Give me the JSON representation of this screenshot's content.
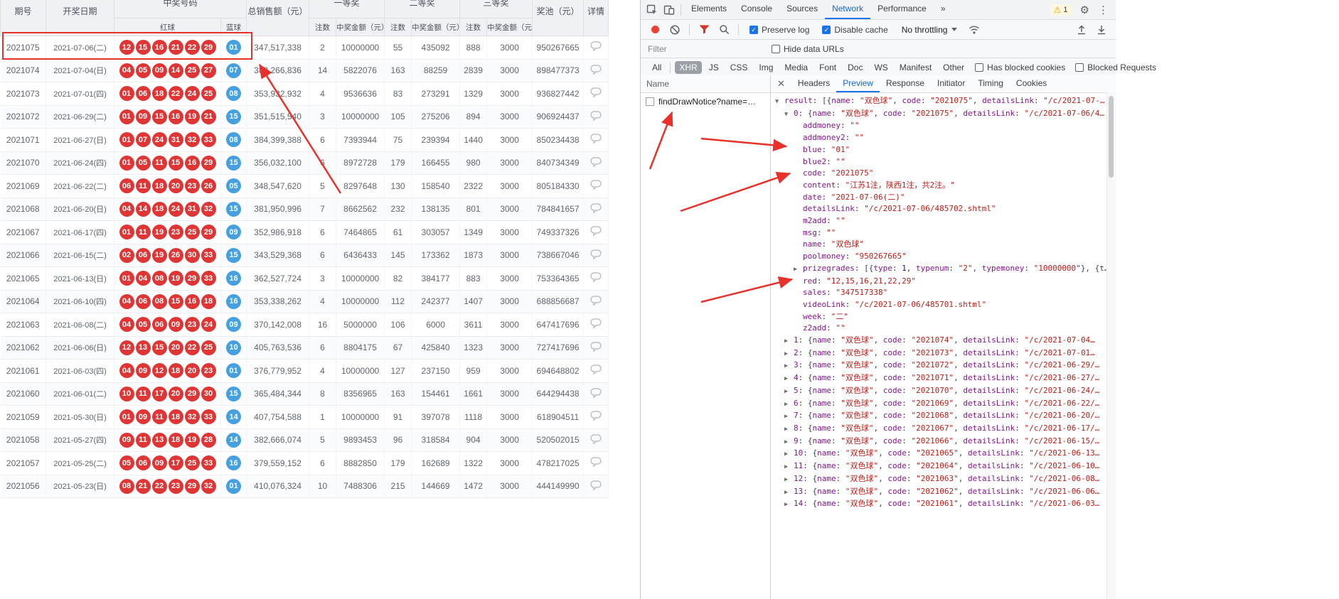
{
  "lottery": {
    "headers": {
      "issue": "期号",
      "date": "开奖日期",
      "numbers": "中奖号码",
      "red": "红球",
      "blue": "蓝球",
      "sales": "总销售额（元）",
      "p1": "一等奖",
      "p2": "二等奖",
      "p3": "三等奖",
      "bets": "注数",
      "amount": "中奖金额（元）",
      "pool": "奖池（元）",
      "detail": "详情"
    },
    "rows": [
      [
        "2021075",
        "2021-07-06(二)",
        "12,15,16,21,22,29",
        "01",
        "347,517,338",
        "2",
        "10000000",
        "55",
        "435092",
        "888",
        "3000",
        "950267665"
      ],
      [
        "2021074",
        "2021-07-04(日)",
        "04,05,09,14,25,27",
        "07",
        "382,266,836",
        "14",
        "5822076",
        "163",
        "88259",
        "2839",
        "3000",
        "898477373"
      ],
      [
        "2021073",
        "2021-07-01(四)",
        "01,06,18,22,24,25",
        "08",
        "353,932,932",
        "4",
        "9536636",
        "83",
        "273291",
        "1329",
        "3000",
        "936827442"
      ],
      [
        "2021072",
        "2021-06-29(二)",
        "01,09,15,16,19,21",
        "15",
        "351,515,540",
        "3",
        "10000000",
        "105",
        "275206",
        "894",
        "3000",
        "906924437"
      ],
      [
        "2021071",
        "2021-06-27(日)",
        "01,07,24,31,32,33",
        "08",
        "384,399,388",
        "6",
        "7393944",
        "75",
        "239394",
        "1440",
        "3000",
        "850234438"
      ],
      [
        "2021070",
        "2021-06-24(四)",
        "01,05,11,15,16,29",
        "15",
        "356,032,100",
        "6",
        "8972728",
        "179",
        "166455",
        "980",
        "3000",
        "840734349"
      ],
      [
        "2021069",
        "2021-06-22(二)",
        "06,11,18,20,23,26",
        "05",
        "348,547,620",
        "5",
        "8297648",
        "130",
        "158540",
        "2322",
        "3000",
        "805184330"
      ],
      [
        "2021068",
        "2021-06-20(日)",
        "04,14,18,24,31,32",
        "15",
        "381,950,996",
        "7",
        "8662562",
        "232",
        "138135",
        "801",
        "3000",
        "784841657"
      ],
      [
        "2021067",
        "2021-06-17(四)",
        "01,11,19,23,25,29",
        "09",
        "352,986,918",
        "6",
        "7464865",
        "61",
        "303057",
        "1349",
        "3000",
        "749337326"
      ],
      [
        "2021066",
        "2021-06-15(二)",
        "02,06,19,26,30,33",
        "15",
        "343,529,368",
        "6",
        "6436433",
        "145",
        "173362",
        "1873",
        "3000",
        "738667046"
      ],
      [
        "2021065",
        "2021-06-13(日)",
        "01,04,08,19,29,33",
        "16",
        "362,527,724",
        "3",
        "10000000",
        "82",
        "384177",
        "883",
        "3000",
        "753364365"
      ],
      [
        "2021064",
        "2021-06-10(四)",
        "04,06,08,15,16,18",
        "16",
        "353,338,262",
        "4",
        "10000000",
        "112",
        "242377",
        "1407",
        "3000",
        "688856687"
      ],
      [
        "2021063",
        "2021-06-08(二)",
        "04,05,06,09,23,24",
        "09",
        "370,142,008",
        "16",
        "5000000",
        "106",
        "6000",
        "3611",
        "3000",
        "647417696"
      ],
      [
        "2021062",
        "2021-06-06(日)",
        "12,13,15,20,22,25",
        "10",
        "405,763,536",
        "6",
        "8804175",
        "67",
        "425840",
        "1323",
        "3000",
        "727417696"
      ],
      [
        "2021061",
        "2021-06-03(四)",
        "04,09,12,18,20,23",
        "01",
        "376,779,952",
        "4",
        "10000000",
        "127",
        "237150",
        "959",
        "3000",
        "694648802"
      ],
      [
        "2021060",
        "2021-06-01(二)",
        "10,11,17,20,29,30",
        "15",
        "365,484,344",
        "8",
        "8356965",
        "163",
        "154461",
        "1661",
        "3000",
        "644294438"
      ],
      [
        "2021059",
        "2021-05-30(日)",
        "01,09,11,18,32,33",
        "14",
        "407,754,588",
        "1",
        "10000000",
        "91",
        "397078",
        "1118",
        "3000",
        "618904511"
      ],
      [
        "2021058",
        "2021-05-27(四)",
        "09,11,13,18,19,28",
        "14",
        "382,666,074",
        "5",
        "9893453",
        "96",
        "318584",
        "904",
        "3000",
        "520502015"
      ],
      [
        "2021057",
        "2021-05-25(二)",
        "05,06,09,17,25,33",
        "16",
        "379,559,152",
        "6",
        "8882850",
        "179",
        "162689",
        "1322",
        "3000",
        "478217025"
      ],
      [
        "2021056",
        "2021-05-23(日)",
        "08,21,22,23,29,32",
        "01",
        "410,076,324",
        "10",
        "7488306",
        "215",
        "144669",
        "1472",
        "3000",
        "444149990"
      ]
    ]
  },
  "devtools": {
    "main_tabs": [
      "Elements",
      "Console",
      "Sources",
      "Network",
      "Performance"
    ],
    "main_tabs_active": "Network",
    "more_tabs_symbol": "»",
    "warning_count": "1",
    "gear_symbol": "⚙",
    "kebab_symbol": "⋮",
    "toolbar": {
      "preserve_log": "Preserve log",
      "preserve_log_checked": true,
      "disable_cache": "Disable cache",
      "disable_cache_checked": true,
      "throttling": "No throttling"
    },
    "filter": {
      "placeholder": "Filter",
      "hide_data_urls": "Hide data URLs",
      "hide_data_urls_checked": false
    },
    "type_pills": [
      "All",
      "XHR",
      "JS",
      "CSS",
      "Img",
      "Media",
      "Font",
      "Doc",
      "WS",
      "Manifest",
      "Other"
    ],
    "type_pills_active": "XHR",
    "blocked_cookies_label": "Has blocked cookies",
    "blocked_cookies_checked": false,
    "blocked_requests_label": "Blocked Requests",
    "blocked_requests_checked": false,
    "name_column_header": "Name",
    "request_name": "findDrawNotice?name=…",
    "detail_tabs": [
      "Headers",
      "Preview",
      "Response",
      "Initiator",
      "Timing",
      "Cookies"
    ],
    "detail_tabs_active": "Preview",
    "preview": {
      "line_result": [
        [
          "k",
          "result"
        ],
        [
          "p",
          ": [{"
        ],
        [
          "k",
          "name"
        ],
        [
          "p",
          ": "
        ],
        [
          "s",
          "双色球"
        ],
        [
          "p",
          ", "
        ],
        [
          "k",
          "code"
        ],
        [
          "p",
          ": "
        ],
        [
          "s",
          "2021075"
        ],
        [
          "p",
          ", "
        ],
        [
          "k",
          "detailsLink"
        ],
        [
          "p",
          ": "
        ],
        [
          "so",
          "/c/2021-07-…"
        ]
      ],
      "line_zero": [
        [
          "k",
          "0"
        ],
        [
          "p",
          ": {"
        ],
        [
          "k",
          "name"
        ],
        [
          "p",
          ": "
        ],
        [
          "s",
          "双色球"
        ],
        [
          "p",
          ", "
        ],
        [
          "k",
          "code"
        ],
        [
          "p",
          ": "
        ],
        [
          "s",
          "2021075"
        ],
        [
          "p",
          ", "
        ],
        [
          "k",
          "detailsLink"
        ],
        [
          "p",
          ": "
        ],
        [
          "so",
          "/c/2021-07-06/4…"
        ]
      ],
      "props_a": [
        [
          "addmoney",
          ""
        ],
        [
          "addmoney2",
          ""
        ],
        [
          "blue",
          "01"
        ],
        [
          "blue2",
          ""
        ],
        [
          "code",
          "2021075"
        ],
        [
          "content",
          "江苏1注，陕西1注，共2注。"
        ],
        [
          "date",
          "2021-07-06(二)"
        ],
        [
          "detailsLink",
          "/c/2021-07-06/485702.shtml"
        ],
        [
          "m2add",
          ""
        ],
        [
          "msg",
          ""
        ],
        [
          "name",
          "双色球"
        ],
        [
          "poolmoney",
          "950267665"
        ]
      ],
      "line_prizegrades": [
        [
          "k",
          "prizegrades"
        ],
        [
          "p",
          ": [{"
        ],
        [
          "k",
          "type"
        ],
        [
          "p",
          ": "
        ],
        [
          "n",
          "1"
        ],
        [
          "p",
          ", "
        ],
        [
          "k",
          "typenum"
        ],
        [
          "p",
          ": "
        ],
        [
          "s",
          "2"
        ],
        [
          "p",
          ", "
        ],
        [
          "k",
          "typemoney"
        ],
        [
          "p",
          ": "
        ],
        [
          "s",
          "10000000"
        ],
        [
          "p",
          "}, {t…"
        ]
      ],
      "props_b": [
        [
          "red",
          "12,15,16,21,22,29"
        ],
        [
          "sales",
          "347517338"
        ],
        [
          "videoLink",
          "/c/2021-07-06/485701.shtml"
        ],
        [
          "week",
          "二"
        ],
        [
          "z2add",
          ""
        ]
      ],
      "item_keys": [
        "name",
        "code",
        "detailsLink"
      ],
      "item_name": "双色球",
      "items": [
        [
          "1",
          "2021074",
          "/c/2021-07-04…"
        ],
        [
          "2",
          "2021073",
          "/c/2021-07-01…"
        ],
        [
          "3",
          "2021072",
          "/c/2021-06-29/…"
        ],
        [
          "4",
          "2021071",
          "/c/2021-06-27/…"
        ],
        [
          "5",
          "2021070",
          "/c/2021-06-24/…"
        ],
        [
          "6",
          "2021069",
          "/c/2021-06-22/…"
        ],
        [
          "7",
          "2021068",
          "/c/2021-06-20/…"
        ],
        [
          "8",
          "2021067",
          "/c/2021-06-17/…"
        ],
        [
          "9",
          "2021066",
          "/c/2021-06-15/…"
        ],
        [
          "10",
          "2021065",
          "/c/2021-06-13…"
        ],
        [
          "11",
          "2021064",
          "/c/2021-06-10…"
        ],
        [
          "12",
          "2021063",
          "/c/2021-06-08…"
        ],
        [
          "13",
          "2021062",
          "/c/2021-06-06…"
        ],
        [
          "14",
          "2021061",
          "/c/2021-06-03…"
        ]
      ]
    }
  }
}
